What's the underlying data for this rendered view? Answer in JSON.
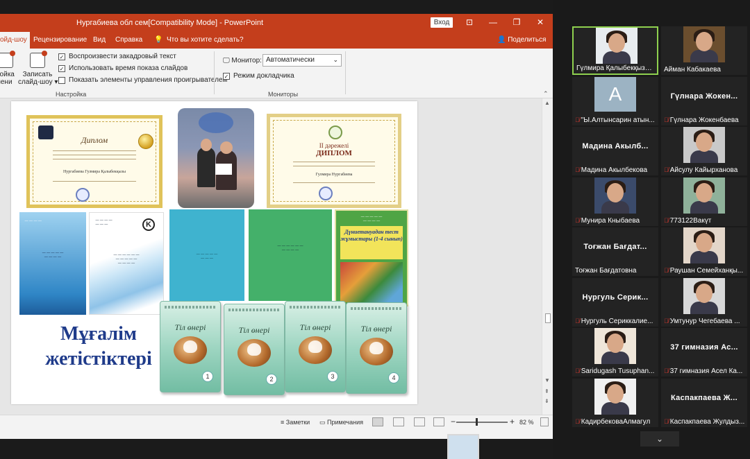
{
  "window": {
    "title": "Нургабиева обл сем[Compatibility Mode]  -  PowerPoint",
    "sign_in": "Вход"
  },
  "tabs": {
    "active": "ойд-шоу",
    "items": [
      "Рецензирование",
      "Вид",
      "Справка"
    ],
    "tell_me": "Что вы хотите сделать?",
    "share": "Поделиться"
  },
  "ribbon": {
    "btn_timing": "ройка\nмени",
    "btn_record": "Записать\nслайд-шоу ▾",
    "chk_narration": "Воспроизвести закадровый текст",
    "chk_timings": "Использовать время показа слайдов",
    "chk_media_controls": "Показать элементы управления проигрывателем",
    "group_setup": "Настройка",
    "monitor_label": "Монитор:",
    "monitor_value": "Автоматически",
    "chk_presenter": "Режим докладчика",
    "group_monitors": "Мониторы"
  },
  "slide": {
    "title_line1": "Мұғалім",
    "title_line2": "жетістіктері",
    "cert1_title": "Диплом",
    "cert1_name": "Нургабиева Гулмира Қалыбекқызы",
    "cert2_heading": "ІІ дәрежелі",
    "cert2_title": "ДИПЛОМ",
    "cert2_name": "Гулмира Нургабиева",
    "book_k_logo": "K",
    "book_test_title": "Дүниетануадан тест жұмыстары (1-4 сынып)",
    "textbooks": [
      {
        "title": "Тіл өнері",
        "num": "1"
      },
      {
        "title": "Тіл өнері",
        "num": "2"
      },
      {
        "title": "Тіл өнері",
        "num": "3"
      },
      {
        "title": "Тіл өнері",
        "num": "4"
      }
    ]
  },
  "statusbar": {
    "notes": "Заметки",
    "comments": "Примечания",
    "zoom_minus": "−",
    "zoom_plus": "+",
    "zoom": "82 %"
  },
  "participants": [
    {
      "name": "Гүлмира Қалыбекқызы ...",
      "type": "video",
      "bg": "#e8ecef",
      "muted": false,
      "active": true
    },
    {
      "name": "Айман Кабакаева",
      "type": "video",
      "bg": "#6b4e2e",
      "muted": false,
      "active": false
    },
    {
      "name": "\"Ы.Алтынсарин атын...",
      "type": "avatar",
      "letter": "A",
      "muted": true
    },
    {
      "name": "Гүлнара Жокенбаева",
      "type": "name",
      "big": "Гүлнара  Жокен...",
      "muted": true
    },
    {
      "name": "Мадина Акылбекова",
      "type": "name",
      "big": "Мадина  Акылб...",
      "muted": true
    },
    {
      "name": "Айсулу Кайырханова",
      "type": "video",
      "bg": "#c9c9c9",
      "muted": true
    },
    {
      "name": "Мунира Кныбаева",
      "type": "video",
      "bg": "#3b4b6b",
      "muted": true
    },
    {
      "name": "773122Вакүт",
      "type": "video",
      "bg": "#8fb19a",
      "muted": true
    },
    {
      "name": "Тоғжан Бағдатовна",
      "type": "name",
      "big": "Тоғжан  Бағдат...",
      "muted": false
    },
    {
      "name": "Раушан Семейханқы...",
      "type": "video",
      "bg": "#e3d6c9",
      "muted": true
    },
    {
      "name": "Нургуль Сериккалие...",
      "type": "name",
      "big": "Нургуль  Серик...",
      "muted": true
    },
    {
      "name": "Умтунур Чегебаева ...",
      "type": "video",
      "bg": "#d8d8d8",
      "muted": true
    },
    {
      "name": "Saridugash Tusuphan...",
      "type": "video",
      "bg": "#efe6d9",
      "muted": true
    },
    {
      "name": "37 гимназия Асел Ка...",
      "type": "name",
      "big": "37  гимназия  Ас...",
      "muted": true
    },
    {
      "name": "КадирбековаАлмагул",
      "type": "video",
      "bg": "#f0f0f0",
      "muted": true
    },
    {
      "name": "Каспакпаева Жулдыз...",
      "type": "name",
      "big": "Каспакпаева  Ж...",
      "muted": true
    }
  ],
  "panel": {
    "scroll_down": "⌄"
  }
}
